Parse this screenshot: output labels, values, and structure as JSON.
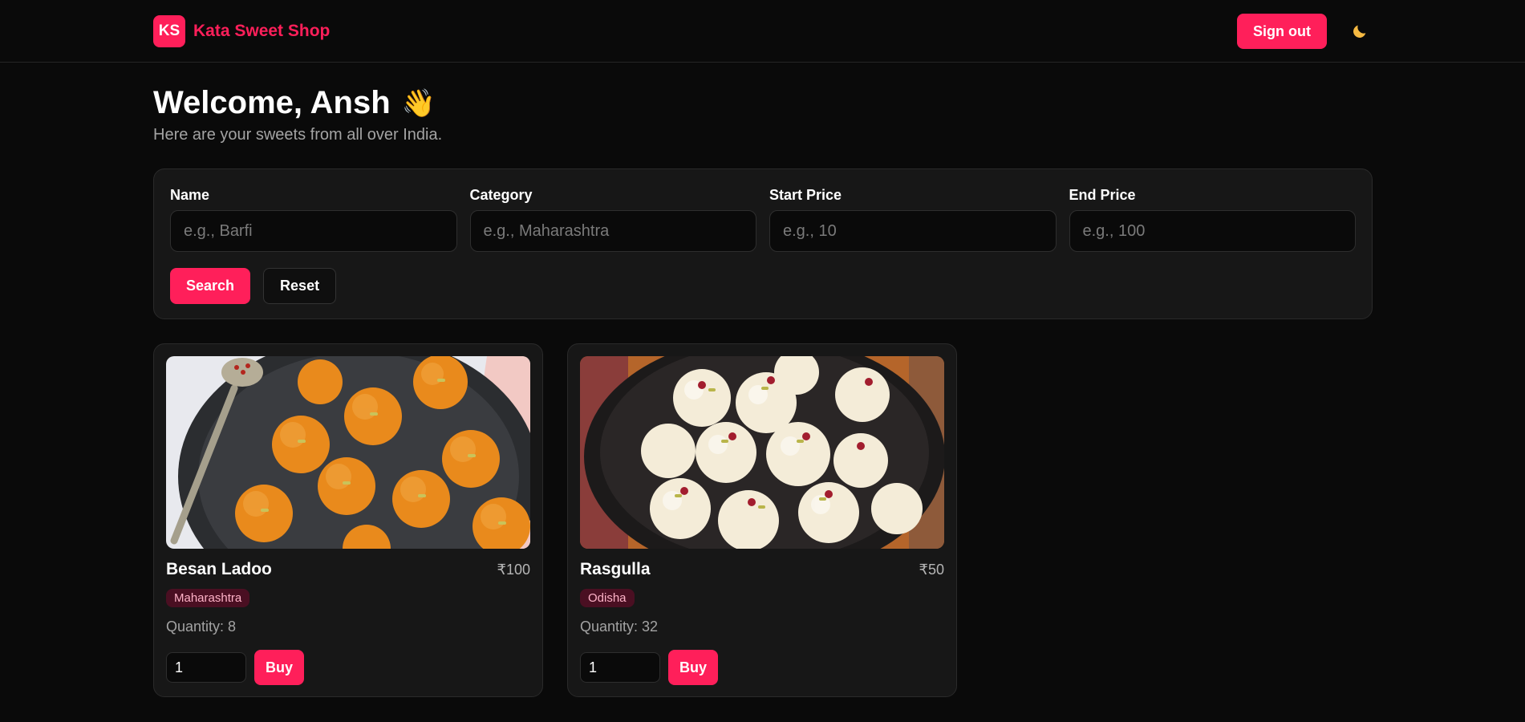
{
  "header": {
    "logo_text": "KS",
    "brand": "Kata Sweet Shop",
    "signout_label": "Sign out",
    "theme_icon": "moon-icon"
  },
  "hero": {
    "welcome": "Welcome, Ansh",
    "wave": "👋",
    "subtitle": "Here are your sweets from all over India."
  },
  "filters": {
    "name": {
      "label": "Name",
      "placeholder": "e.g., Barfi",
      "value": ""
    },
    "category": {
      "label": "Category",
      "placeholder": "e.g., Maharashtra",
      "value": ""
    },
    "start_price": {
      "label": "Start Price",
      "placeholder": "e.g., 10",
      "value": ""
    },
    "end_price": {
      "label": "End Price",
      "placeholder": "e.g., 100",
      "value": ""
    },
    "search_label": "Search",
    "reset_label": "Reset"
  },
  "sweets": [
    {
      "name": "Besan Ladoo",
      "price": "₹100",
      "category": "Maharashtra",
      "quantity_text": "Quantity: 8",
      "buy_qty": "1",
      "buy_label": "Buy"
    },
    {
      "name": "Rasgulla",
      "price": "₹50",
      "category": "Odisha",
      "quantity_text": "Quantity: 32",
      "buy_qty": "1",
      "buy_label": "Buy"
    }
  ],
  "colors": {
    "accent": "#ff1f5a",
    "background": "#0a0a0a",
    "panel": "#171717"
  }
}
